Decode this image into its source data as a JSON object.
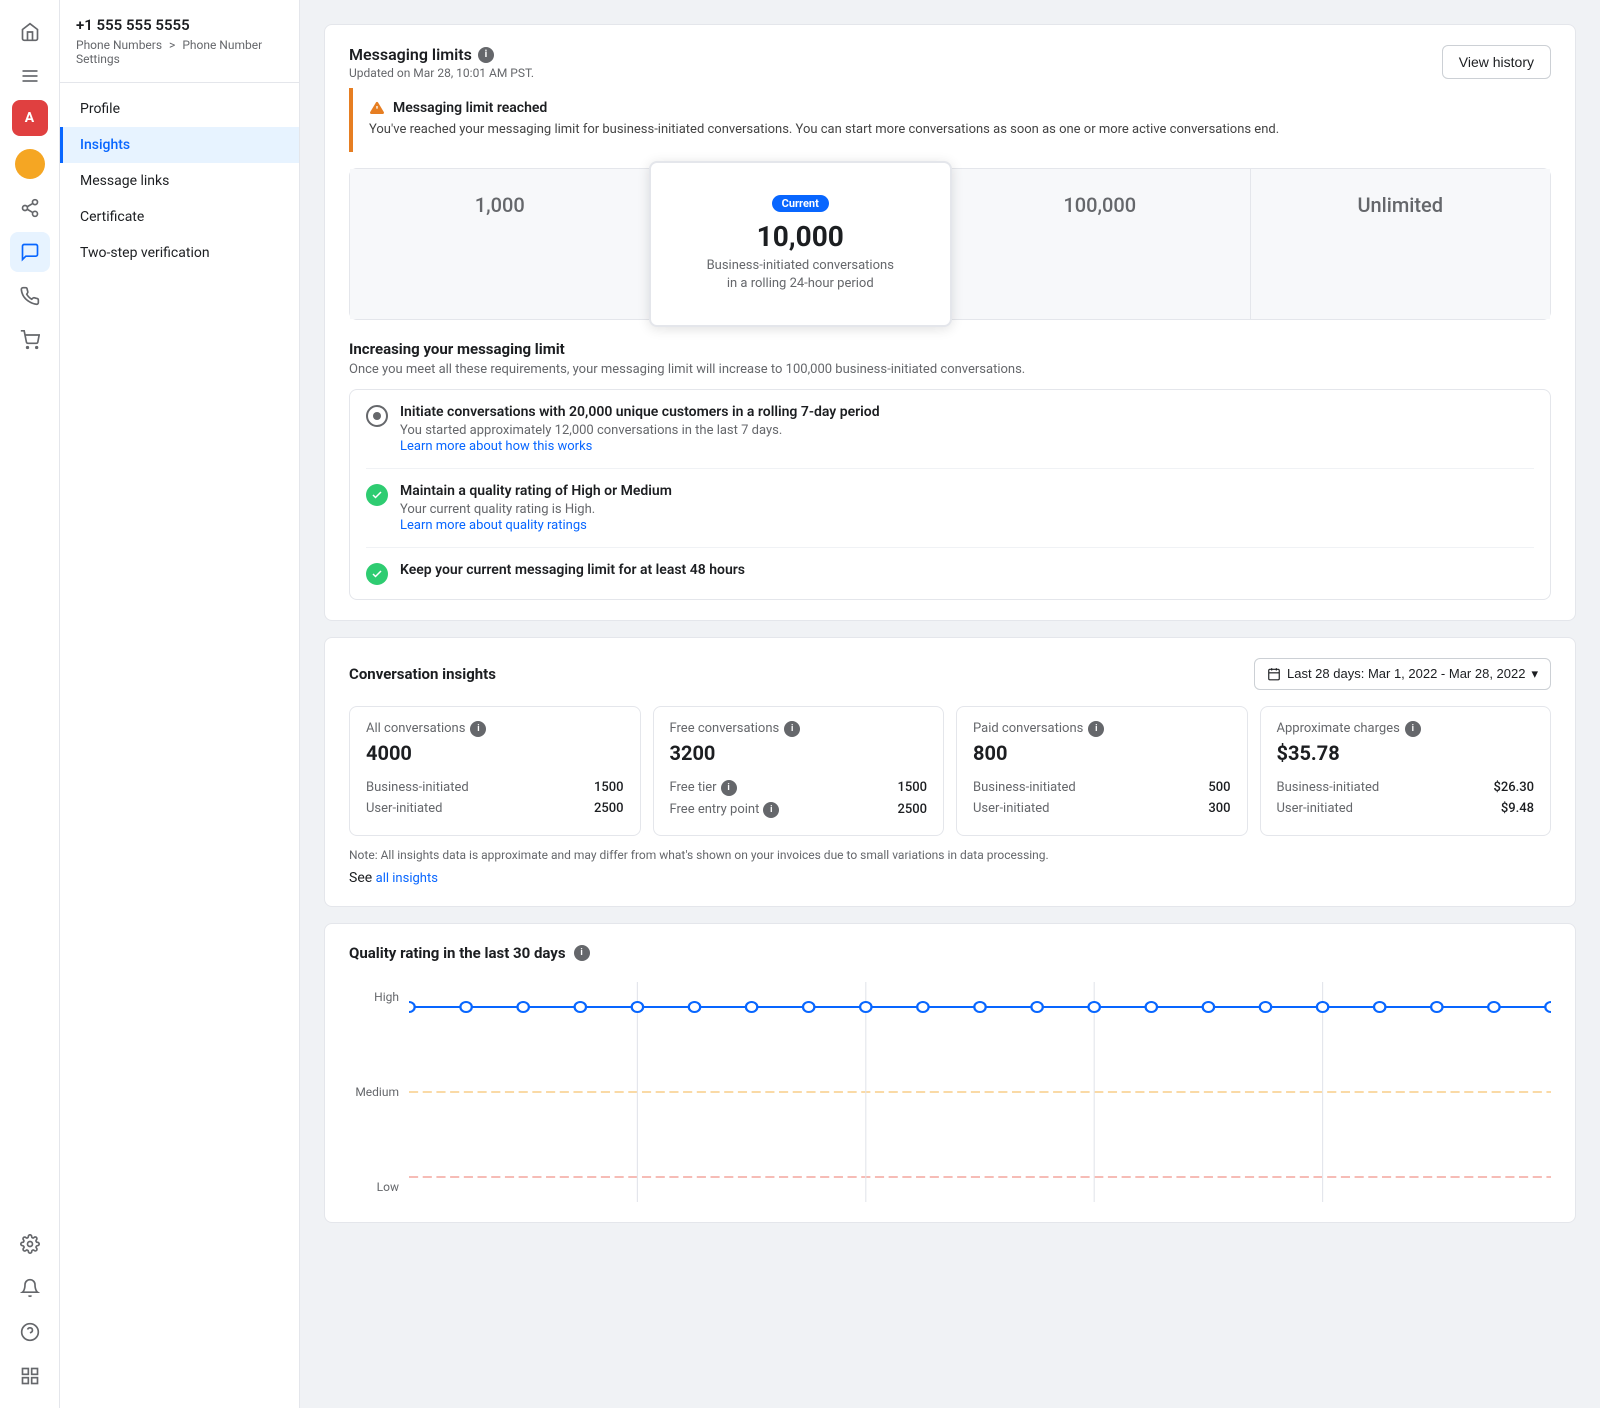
{
  "phone": {
    "number": "+1 555 555 5555",
    "breadcrumb_part1": "Phone Numbers",
    "breadcrumb_sep": ">",
    "breadcrumb_part2": "Phone Number Settings"
  },
  "sidebar": {
    "items": [
      {
        "id": "profile",
        "label": "Profile",
        "active": false
      },
      {
        "id": "insights",
        "label": "Insights",
        "active": true
      },
      {
        "id": "message-links",
        "label": "Message links",
        "active": false
      },
      {
        "id": "certificate",
        "label": "Certificate",
        "active": false
      },
      {
        "id": "two-step",
        "label": "Two-step verification",
        "active": false
      }
    ]
  },
  "messaging_limits": {
    "title": "Messaging limits",
    "updated": "Updated on Mar 28, 10:01 AM PST.",
    "view_history_btn": "View history",
    "alert_title": "Messaging limit reached",
    "alert_body": "You've reached your messaging limit for business-initiated conversations. You can start more conversations as soon as one or more active conversations end.",
    "tiers": [
      {
        "value": "1,000",
        "label": "",
        "active": false
      },
      {
        "badge": "Current",
        "value": "10,000",
        "label": "Business-initiated conversations\nin a rolling 24-hour period",
        "active": true
      },
      {
        "value": "100,000",
        "label": "",
        "active": false
      },
      {
        "value": "Unlimited",
        "label": "",
        "active": false
      }
    ],
    "increase_title": "Increasing your messaging limit",
    "increase_subtitle": "Once you meet all these requirements, your messaging limit will increase to 100,000 business-initiated conversations.",
    "requirements": [
      {
        "status": "partial",
        "title": "Initiate conversations with 20,000 unique customers in a rolling 7-day period",
        "desc": "You started approximately 12,000 conversations in the last 7 days.",
        "link": "Learn more about how this works"
      },
      {
        "status": "done",
        "title": "Maintain a quality rating of High or Medium",
        "desc": "Your current quality rating is High.",
        "link": "Learn more about quality ratings"
      },
      {
        "status": "done",
        "title": "Keep your current messaging limit for at least 48 hours",
        "desc": "",
        "link": ""
      }
    ]
  },
  "conversation_insights": {
    "title": "Conversation insights",
    "date_range_btn": "Last 28 days: Mar 1, 2022 - Mar 28, 2022",
    "cards": [
      {
        "title": "All conversations",
        "value": "4000",
        "rows": [
          {
            "label": "Business-initiated",
            "value": "1500"
          },
          {
            "label": "User-initiated",
            "value": "2500"
          }
        ]
      },
      {
        "title": "Free conversations",
        "value": "3200",
        "rows": [
          {
            "label": "Free tier",
            "value": "1500",
            "has_info": true
          },
          {
            "label": "Free entry point",
            "value": "2500",
            "has_info": true
          }
        ]
      },
      {
        "title": "Paid conversations",
        "value": "800",
        "rows": [
          {
            "label": "Business-initiated",
            "value": "500"
          },
          {
            "label": "User-initiated",
            "value": "300"
          }
        ]
      },
      {
        "title": "Approximate charges",
        "value": "$35.78",
        "rows": [
          {
            "label": "Business-initiated",
            "value": "$26.30"
          },
          {
            "label": "User-initiated",
            "value": "$9.48"
          }
        ]
      }
    ],
    "note": "Note: All insights data is approximate and may differ from what's shown on your invoices due to small variations in data processing.",
    "see_all": "See",
    "see_all_link": "all insights"
  },
  "quality_rating": {
    "title": "Quality rating in the last 30 days",
    "y_labels": [
      "High",
      "Medium",
      "Low"
    ],
    "line_color": "#0866ff",
    "high_color": "#27ae60",
    "medium_color": "#f39c12",
    "low_color": "#e74c3c"
  },
  "icons": {
    "home": "⌂",
    "menu": "☰",
    "red_square": "■",
    "circle": "●",
    "branch": "⑂",
    "chat": "💬",
    "phone": "📞",
    "cart": "🛒",
    "gear": "⚙",
    "bell": "🔔",
    "question": "?",
    "grid": "⊞",
    "warning": "⚠",
    "check": "✓",
    "info": "i",
    "calendar": "📅",
    "chevron_down": "▾"
  }
}
